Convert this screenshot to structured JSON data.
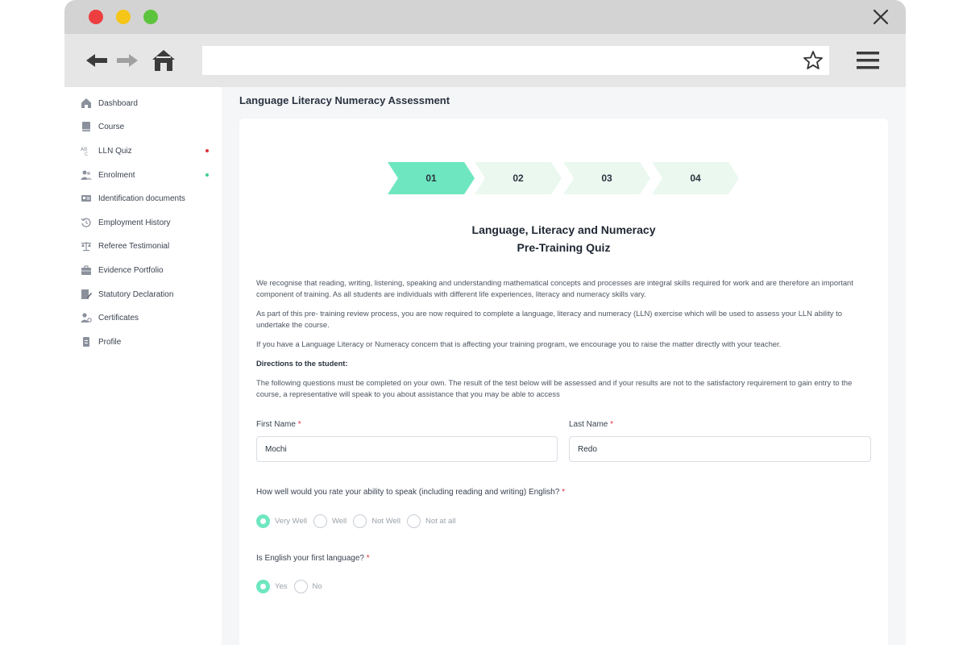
{
  "browser": {
    "url": "",
    "icons": [
      "close-icon",
      "back-arrow-icon",
      "forward-arrow-icon",
      "home-icon",
      "star-icon",
      "hamburger-menu-icon"
    ]
  },
  "colors": {
    "accent": "#6ee7c0",
    "step_inactive": "#ebf8ef",
    "required": "#e0303a",
    "badge_red": "#e0303a",
    "badge_green": "#3ecf8e"
  },
  "sidebar": {
    "items": [
      {
        "label": "Dashboard",
        "icon": "home-icon"
      },
      {
        "label": "Course",
        "icon": "book-icon"
      },
      {
        "label": "LLN Quiz",
        "icon": "abc-icon",
        "badge": "red"
      },
      {
        "label": "Enrolment",
        "icon": "users-icon",
        "badge": "green"
      },
      {
        "label": "Identification documents",
        "icon": "id-card-icon"
      },
      {
        "label": "Employment History",
        "icon": "history-icon"
      },
      {
        "label": "Referee Testimonial",
        "icon": "scale-icon"
      },
      {
        "label": "Evidence Portfolio",
        "icon": "briefcase-icon"
      },
      {
        "label": "Statutory Declaration",
        "icon": "document-edit-icon"
      },
      {
        "label": "Certificates",
        "icon": "certificate-user-icon"
      },
      {
        "label": "Profile",
        "icon": "profile-icon"
      }
    ]
  },
  "main": {
    "page_title": "Language Literacy Numeracy Assessment",
    "steps": [
      {
        "label": "01",
        "state": "active"
      },
      {
        "label": "02",
        "state": "inactive"
      },
      {
        "label": "03",
        "state": "inactive"
      },
      {
        "label": "04",
        "state": "inactive"
      }
    ],
    "quiz_title_line1": "Language, Literacy and Numeracy",
    "quiz_title_line2": "Pre-Training Quiz",
    "paragraphs": {
      "p1": "We recognise that reading, writing, listening, speaking and understanding mathematical concepts and processes are integral skills required for work and are therefore an important component of training. As all students are individuals with different life experiences, literacy and numeracy skills vary.",
      "p2": "As part of this pre- training review process, you are now required to complete a language, literacy and numeracy (LLN) exercise which will be used to assess your LLN ability to undertake the course.",
      "p3": "If you have a Language Literacy or Numeracy concern that is affecting your training program, we encourage you to raise the matter directly with your teacher.",
      "directions_heading": "Directions to the student:",
      "p4": "The following questions must be completed on your own. The result of the test below will be assessed and if your results are not to the satisfactory requirement to gain entry to the course, a representative will speak to you about assistance that you may be able to access"
    },
    "form": {
      "first_name_label": "First Name",
      "first_name_value": "Mochi",
      "last_name_label": "Last Name",
      "last_name_value": "Redo",
      "required_mark": "*",
      "q1": {
        "text": "How well would you rate your ability to speak (including reading and writing) English?",
        "options": [
          "Very Well",
          "Well",
          "Not Well",
          "Not at all"
        ],
        "selected": "Very Well"
      },
      "q2": {
        "text": "Is English your first language?",
        "options": [
          "Yes",
          "No"
        ],
        "selected": "Yes"
      }
    }
  }
}
